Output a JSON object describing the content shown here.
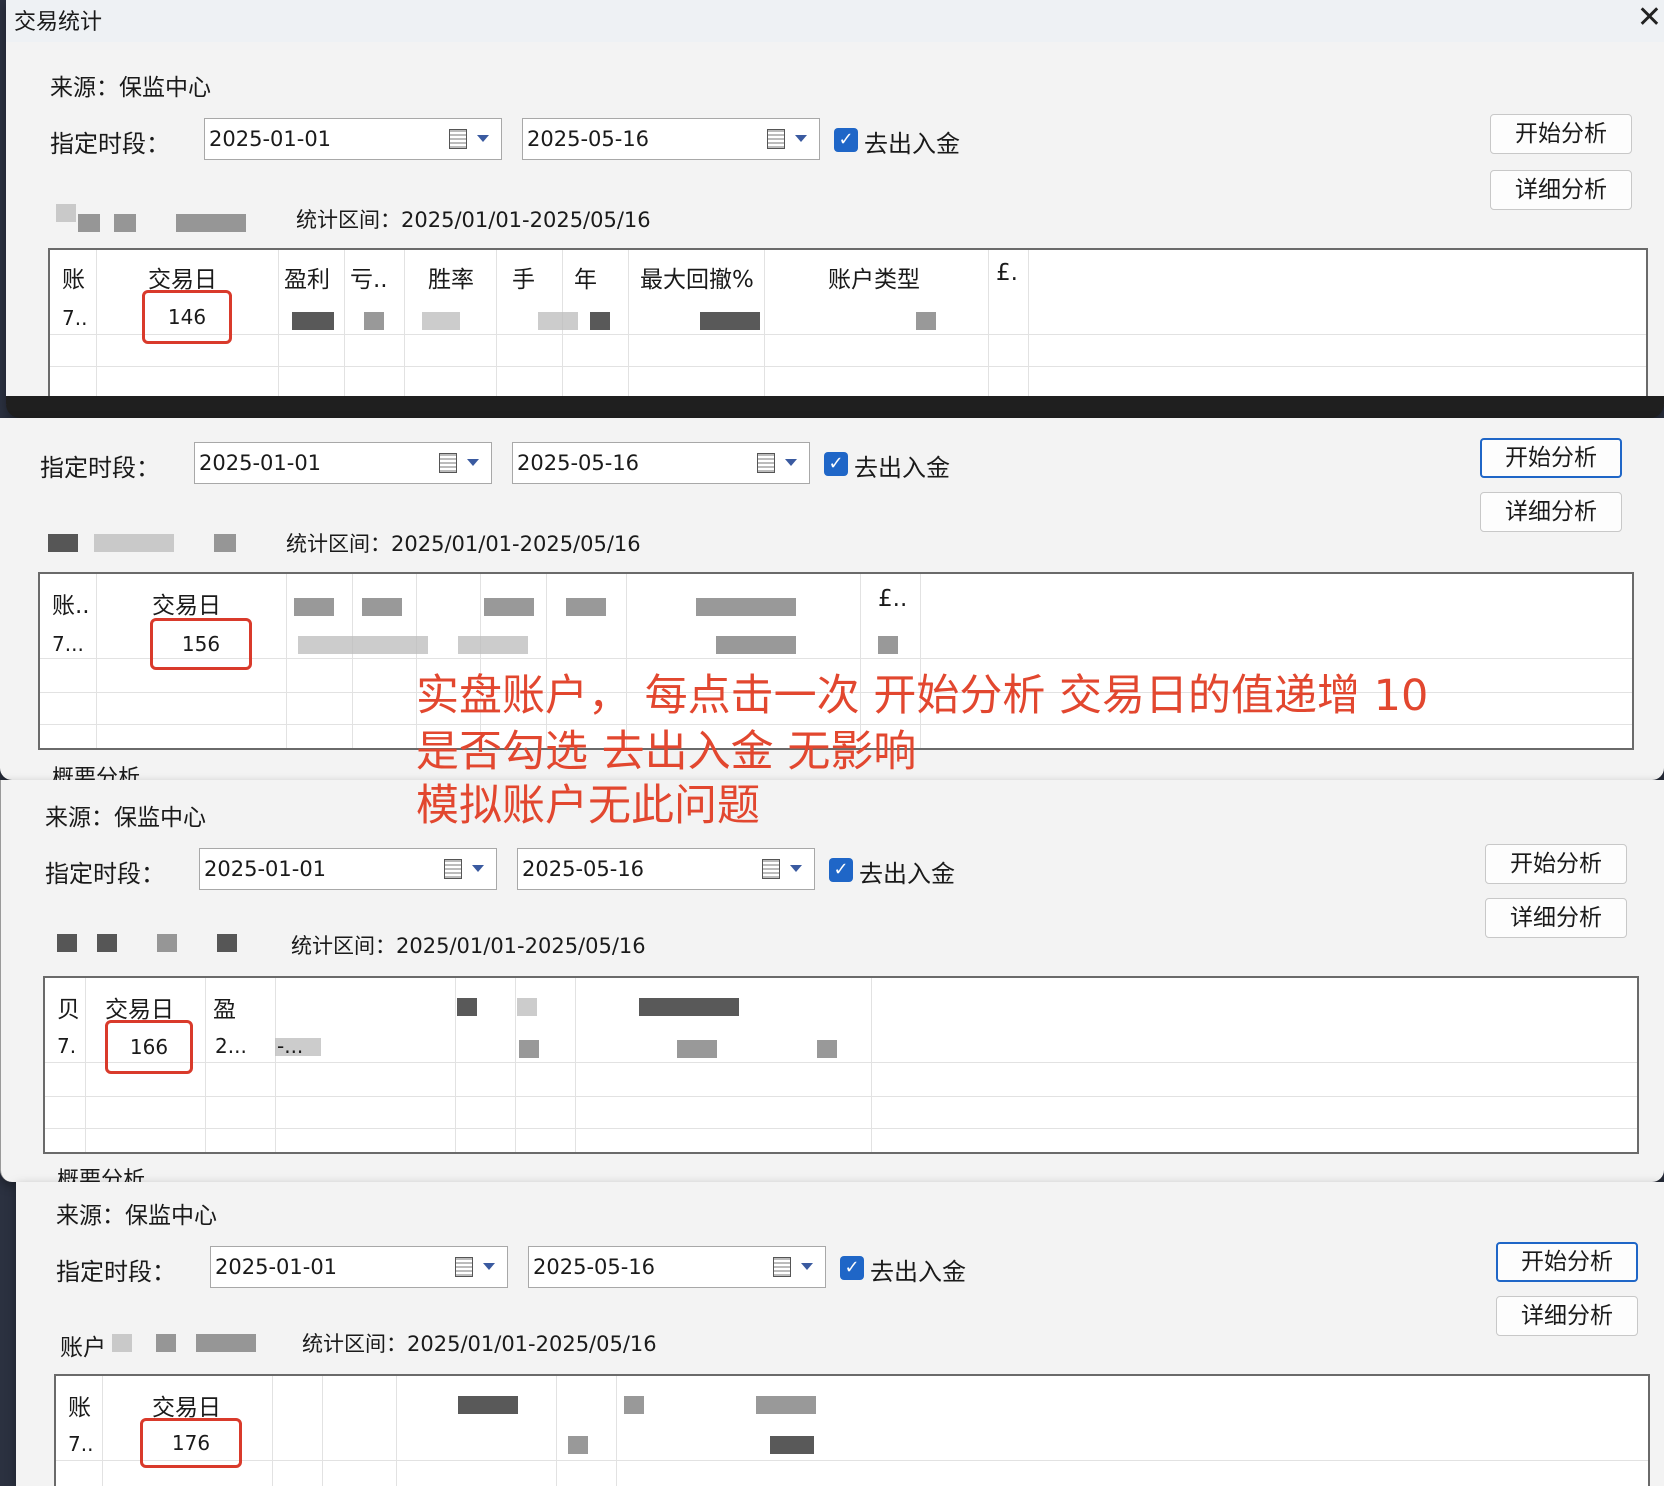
{
  "window": {
    "title": "交易统计",
    "close_symbol": "✕"
  },
  "labels": {
    "source": "来源：保监中心",
    "period": "指定时段：",
    "exclude_funds": "去出入金",
    "start_button": "开始分析",
    "detail_button": "详细分析",
    "range": "统计区间：2025/01/01-2025/05/16",
    "overview": "概要分析",
    "account_prefix": "账户",
    "check_mark": "✓"
  },
  "dates": {
    "start": "2025-01-01",
    "end": "2025-05-16"
  },
  "panels": [
    {
      "headers": [
        "账",
        "交易日",
        "盈利",
        "亏..",
        "胜率",
        "手",
        "年",
        "最大回撤%",
        "账户类型",
        "£."
      ],
      "row": [
        "7..",
        "146"
      ]
    },
    {
      "headers": [
        "账..",
        "交易日",
        "",
        "",
        "",
        "",
        "",
        "",
        "",
        "£.."
      ],
      "row": [
        "7...",
        "156"
      ]
    },
    {
      "headers": [
        "贝",
        "交易日",
        "盈"
      ],
      "row": [
        "7.",
        "166",
        "2...",
        "-..."
      ]
    },
    {
      "headers": [
        "账",
        "交易日"
      ],
      "row": [
        "7..",
        "176"
      ]
    }
  ],
  "annotation": {
    "line1": "实盘账户， 每点击一次 开始分析 交易日的值递增 10",
    "line2": "是否勾选 去出入金 无影响",
    "line3": "模拟账户无此问题"
  }
}
